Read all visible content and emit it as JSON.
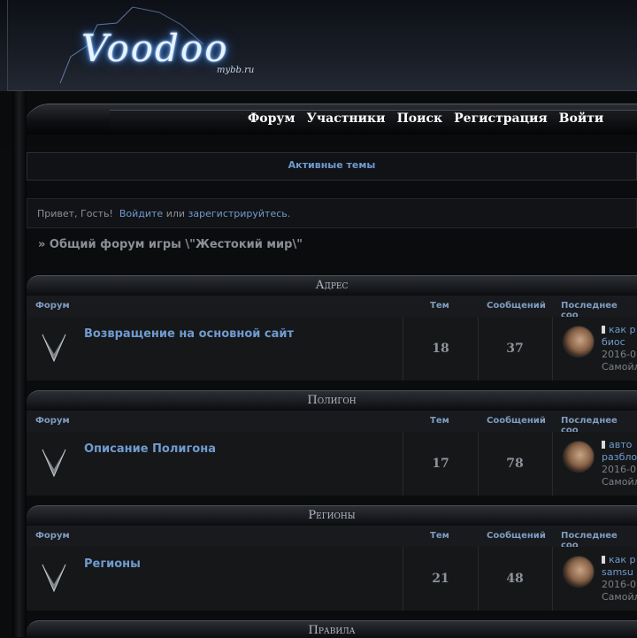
{
  "logo": {
    "text": "Voodoo",
    "sub": "mybb.ru"
  },
  "nav": [
    "Форум",
    "Участники",
    "Поиск",
    "Регистрация",
    "Войти"
  ],
  "active_topics": "Активные темы",
  "greeting": {
    "prefix": "Привет, Гость!",
    "login": "Войдите",
    "or": "или",
    "register": "зарегистрируйтесь",
    "period": "."
  },
  "forum_title": "» Общий форум игры \\\"Жестокий мир\\\"",
  "columns": {
    "forum": "Форум",
    "topics": "Тем",
    "posts": "Сообщений",
    "last": "Последнее соо"
  },
  "categories": [
    {
      "name": "Адрес",
      "forum": "Возвращение на основной сайт",
      "topics": "18",
      "posts": "37",
      "last_line1": "как р",
      "last_line2": "биос",
      "last_date": "2016-0",
      "last_user": "Самойл"
    },
    {
      "name": "Полигон",
      "forum": "Описание Полигона",
      "topics": "17",
      "posts": "78",
      "last_line1": "авто",
      "last_line2": "разбло",
      "last_date": "2016-0",
      "last_user": "Самойл"
    },
    {
      "name": "Регионы",
      "forum": "Регионы",
      "topics": "21",
      "posts": "48",
      "last_line1": "как р",
      "last_line2": "samsu",
      "last_date": "2016-0",
      "last_user": "Самойл"
    },
    {
      "name": "Правила"
    }
  ]
}
